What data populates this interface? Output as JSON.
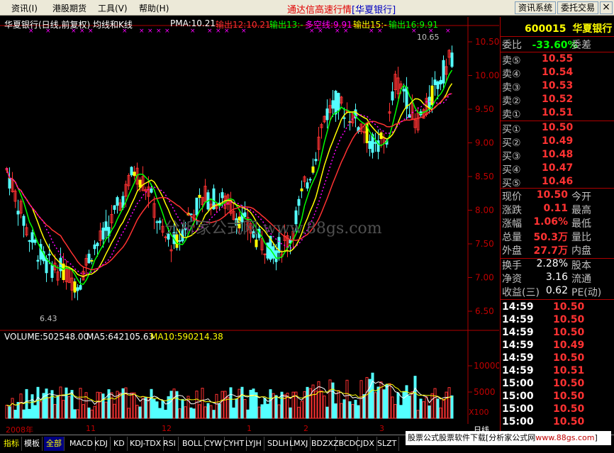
{
  "menu": {
    "items": [
      "资讯(I)",
      "港股期货",
      "工具(V)",
      "帮助(H)"
    ],
    "title_main": "通达信高速行情",
    "title_stock": "[华夏银行]",
    "btn_info": "资讯系统",
    "btn_trade": "委托交易",
    "close": "×"
  },
  "header": {
    "stock_title": "华夏银行(日线,前复权) 均线和K线",
    "pma": "PMA:10.21",
    "out12": "输出12:10.21",
    "out13": "输出13:-",
    "duokong": "多空线:9.91",
    "out15": "输出15:-",
    "out16": "输出16:9.91"
  },
  "price_axis": [
    "10.50",
    "10.00",
    "9.50",
    "9.00",
    "8.50",
    "8.00",
    "7.50",
    "7.00",
    "6.50"
  ],
  "annotations": {
    "high": "10.65",
    "low": "6.43"
  },
  "watermark": "分析家公式网 www.88gs.com",
  "volume": {
    "vol": "VOLUME:502548.00",
    "ma5": "MA5:642105.63",
    "ma10": "MA10:590214.38",
    "axis": [
      "10000",
      "5000"
    ],
    "unit": "X100"
  },
  "dates": [
    "2008年",
    "11",
    "12",
    "1",
    "2",
    "3"
  ],
  "colors": {
    "up": "#ff3232",
    "down": "#54ffff",
    "yellow": "#ffff00",
    "green": "#00ff00",
    "magenta": "#ff00ff"
  },
  "quote": {
    "code": "600015",
    "name": "华夏银行",
    "wei_bi_label": "委比",
    "wei_bi": "-33.60%",
    "wei_cha_label": "委差",
    "sell": [
      {
        "label": "卖⑤",
        "price": "10.55"
      },
      {
        "label": "卖④",
        "price": "10.54"
      },
      {
        "label": "卖③",
        "price": "10.53"
      },
      {
        "label": "卖②",
        "price": "10.52"
      },
      {
        "label": "卖①",
        "price": "10.51"
      }
    ],
    "buy": [
      {
        "label": "买①",
        "price": "10.50"
      },
      {
        "label": "买②",
        "price": "10.49"
      },
      {
        "label": "买③",
        "price": "10.48"
      },
      {
        "label": "买④",
        "price": "10.47"
      },
      {
        "label": "买⑤",
        "price": "10.46"
      }
    ],
    "stats": [
      {
        "l1": "现价",
        "v1": "10.50",
        "l2": "今开"
      },
      {
        "l1": "涨跌",
        "v1": "0.11",
        "l2": "最高"
      },
      {
        "l1": "涨幅",
        "v1": "1.06%",
        "l2": "最低"
      },
      {
        "l1": "总量",
        "v1": "50.3万",
        "l2": "量比"
      },
      {
        "l1": "外盘",
        "v1": "27.7万",
        "l2": "内盘"
      }
    ],
    "stats2": [
      {
        "l1": "换手",
        "v1": "2.28%",
        "l2": "股本"
      },
      {
        "l1": "净资",
        "v1": "3.16",
        "l2": "流通"
      },
      {
        "l1": "收益(三)",
        "v1": "0.62",
        "l2": "PE(动)"
      }
    ],
    "ticks": [
      {
        "t": "14:59",
        "p": "10.50"
      },
      {
        "t": "14:59",
        "p": "10.50"
      },
      {
        "t": "14:59",
        "p": "10.50"
      },
      {
        "t": "14:59",
        "p": "10.49"
      },
      {
        "t": "14:59",
        "p": "10.50"
      },
      {
        "t": "14:59",
        "p": "10.51"
      },
      {
        "t": "15:00",
        "p": "10.50"
      },
      {
        "t": "15:00",
        "p": "10.50"
      },
      {
        "t": "15:00",
        "p": "10.50"
      },
      {
        "t": "15:00",
        "p": "10.50"
      }
    ]
  },
  "day_label": "日线",
  "tabs": [
    "指标",
    "模板",
    "全部",
    "MACD",
    "KDJ",
    "KD",
    "KDJ-TDX",
    "RSI",
    "BOLL",
    "CYW",
    "CYHT",
    "LYJH",
    "SDLH",
    "LMXJ",
    "BDZX",
    "ZBCD",
    "CJDX",
    "SLZT"
  ],
  "ad": {
    "text": "股票公式股票软件下载[分析家公式网",
    "url": "www.88gs.com",
    "end": "]"
  }
}
